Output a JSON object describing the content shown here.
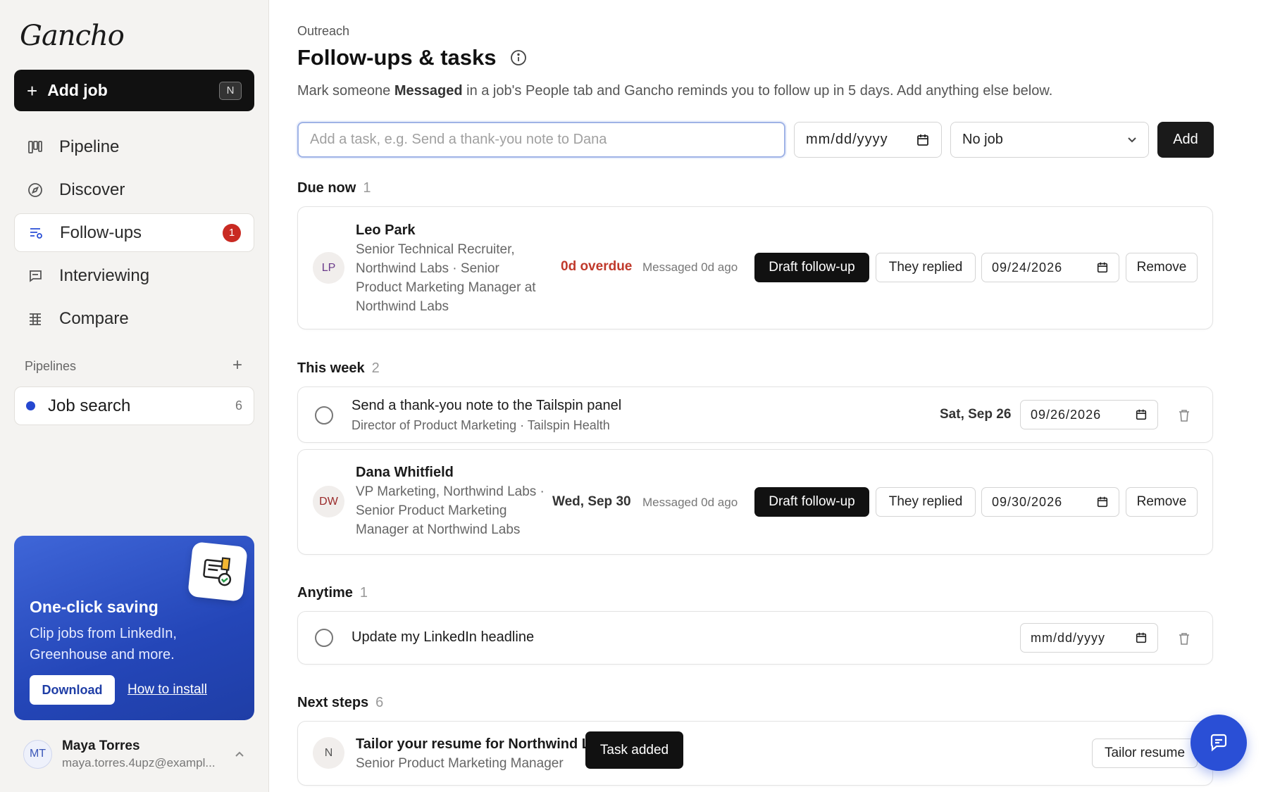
{
  "app": {
    "name": "Gancho"
  },
  "sidebar": {
    "add_job": {
      "label": "Add job",
      "shortcut": "N"
    },
    "nav": [
      {
        "label": "Pipeline",
        "icon": "kanban-icon"
      },
      {
        "label": "Discover",
        "icon": "compass-icon"
      },
      {
        "label": "Follow-ups",
        "icon": "list-icon",
        "badge": "1",
        "active": true
      },
      {
        "label": "Interviewing",
        "icon": "chat-bubble-icon"
      },
      {
        "label": "Compare",
        "icon": "table-icon"
      }
    ],
    "pipelines_label": "Pipelines",
    "pipelines": [
      {
        "label": "Job search",
        "count": "6",
        "color": "#2547d0"
      }
    ],
    "promo": {
      "title": "One-click saving",
      "text": "Clip jobs from LinkedIn, Greenhouse and more.",
      "download": "Download",
      "install": "How to install"
    },
    "user": {
      "initials": "MT",
      "name": "Maya Torres",
      "email": "maya.torres.4upz@exampl..."
    }
  },
  "main": {
    "breadcrumb": "Outreach",
    "title": "Follow-ups & tasks",
    "subtitle_pre": "Mark someone ",
    "subtitle_bold": "Messaged",
    "subtitle_post": " in a job's People tab and Gancho reminds you to follow up in 5 days. Add anything else below.",
    "task_placeholder": "Add a task, e.g. Send a thank-you note to Dana",
    "date_placeholder": "mm/dd/yyyy",
    "job_select": "No job",
    "add_label": "Add",
    "sections": {
      "due_now": {
        "label": "Due now",
        "count": "1"
      },
      "this_week": {
        "label": "This week",
        "count": "2"
      },
      "anytime": {
        "label": "Anytime",
        "count": "1"
      },
      "next_steps": {
        "label": "Next steps",
        "count": "6"
      }
    },
    "due_now_items": [
      {
        "initials": "LP",
        "name": "Leo Park",
        "subtitle": "Senior Technical Recruiter, Northwind Labs · Senior Product Marketing Manager at Northwind Labs",
        "status": "0d overdue",
        "messaged": "Messaged 0d ago",
        "draft": "Draft follow-up",
        "replied": "They replied",
        "date": "09/24/2026",
        "remove": "Remove"
      }
    ],
    "this_week_task": {
      "title": "Send a thank-you note to the Tailspin panel",
      "subtitle": "Director of Product Marketing · Tailspin Health",
      "due": "Sat, Sep 26",
      "date": "09/26/2026"
    },
    "this_week_person": {
      "initials": "DW",
      "name": "Dana Whitfield",
      "subtitle": "VP Marketing, Northwind Labs · Senior Product Marketing Manager at Northwind Labs",
      "due": "Wed, Sep 30",
      "messaged": "Messaged 0d ago",
      "draft": "Draft follow-up",
      "replied": "They replied",
      "date": "09/30/2026",
      "remove": "Remove"
    },
    "anytime_task": {
      "title": "Update my LinkedIn headline",
      "date": "mm/dd/yyyy"
    },
    "next_step": {
      "initials": "N",
      "title": "Tailor your resume for Northwind L",
      "subtitle": "Senior Product Marketing Manager",
      "action": "Tailor resume"
    },
    "toast": "Task added"
  }
}
